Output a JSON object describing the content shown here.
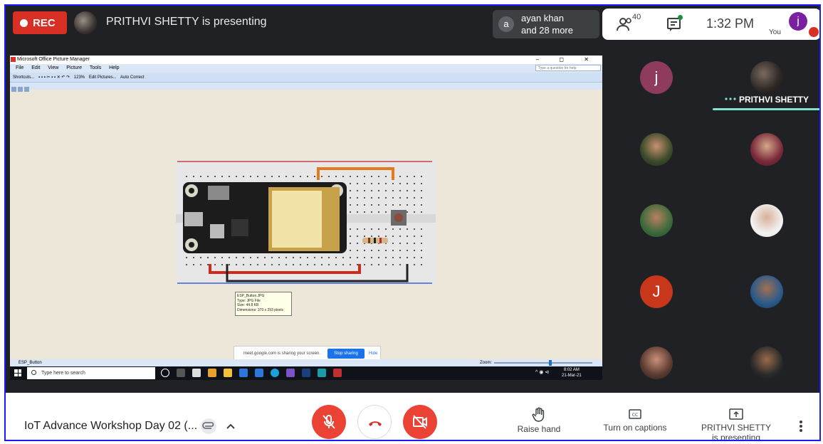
{
  "top_bar": {
    "rec_label": "REC",
    "presenting_text": "PRITHVI SHETTY is presenting",
    "participants": {
      "avatar_letter": "a",
      "line1": "ayan khan",
      "line2": "and 28 more"
    },
    "people_count": "40",
    "time": "1:32 PM",
    "you_avatar_letter": "j",
    "you_label": "You"
  },
  "shared_screen": {
    "window_title": "Microsoft Office Picture Manager",
    "window_controls": "– ◻ ✕",
    "menu": [
      "File",
      "Edit",
      "View",
      "Picture",
      "Tools",
      "Help"
    ],
    "help_placeholder": "Type a question for help",
    "toolbar": [
      "Shortcuts...",
      "123%",
      "Edit Pictures...",
      "Auto Correct"
    ],
    "tooltip": [
      "ESP_Button.JPG",
      "Type: JPG File",
      "Size: 44.8 KB",
      "Dimensions: 370 x 293 pixels"
    ],
    "status_file": "ESP_Button",
    "zoom_label": "Zoom:",
    "share_bar": {
      "text": "meet.google.com is sharing your screen.",
      "stop_label": "Stop sharing",
      "hide_label": "Hide"
    },
    "taskbar": {
      "search_placeholder": "Type here to search",
      "time": "8:02 AM",
      "date": "21-Mar-21"
    }
  },
  "panel": {
    "tiles": [
      {
        "letter": "j",
        "color": "#8e3b5d"
      },
      {
        "name": "PRITHVI SHETTY"
      },
      {
        "photo": "participant-photo"
      },
      {
        "photo": "participant-photo"
      },
      {
        "photo": "participant-photo"
      },
      {
        "photo": "participant-photo"
      },
      {
        "letter": "J",
        "color": "#c8361b"
      },
      {
        "photo": "participant-photo"
      },
      {
        "photo": "participant-photo"
      },
      {
        "photo": "participant-photo"
      }
    ]
  },
  "bottom_bar": {
    "meeting_title": "IoT Advance Workshop Day 02 (...",
    "raise_hand_label": "Raise hand",
    "captions_label": "Turn on captions",
    "presenting_line1": "PRITHVI SHETTY",
    "presenting_line2": "is presenting"
  },
  "colors": {
    "rec": "#d93025",
    "red_control": "#ea4335",
    "active_speaker": "#81e3d0",
    "meet_bg": "#202124"
  }
}
